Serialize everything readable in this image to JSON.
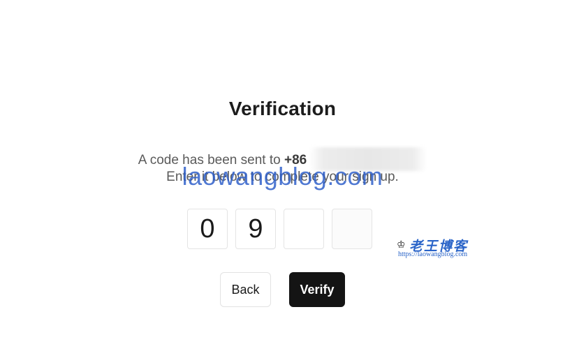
{
  "heading": {
    "title": "Verification"
  },
  "message": {
    "line1_prefix": "A code has been sent to ",
    "phone_prefix": "+86",
    "line2": "Enter it below to complete your sign up."
  },
  "code_inputs": {
    "digits": [
      "0",
      "9",
      "",
      ""
    ]
  },
  "actions": {
    "back_label": "Back",
    "verify_label": "Verify"
  },
  "watermark": {
    "text": "laowangblog.com",
    "logo_name": "老王博客",
    "logo_url": "https://laowangblog.com",
    "logo_icon": "crown-icon"
  },
  "colors": {
    "background": "#ffffff",
    "primary_button": "#141414",
    "watermark_blue": "#2a64c8"
  }
}
